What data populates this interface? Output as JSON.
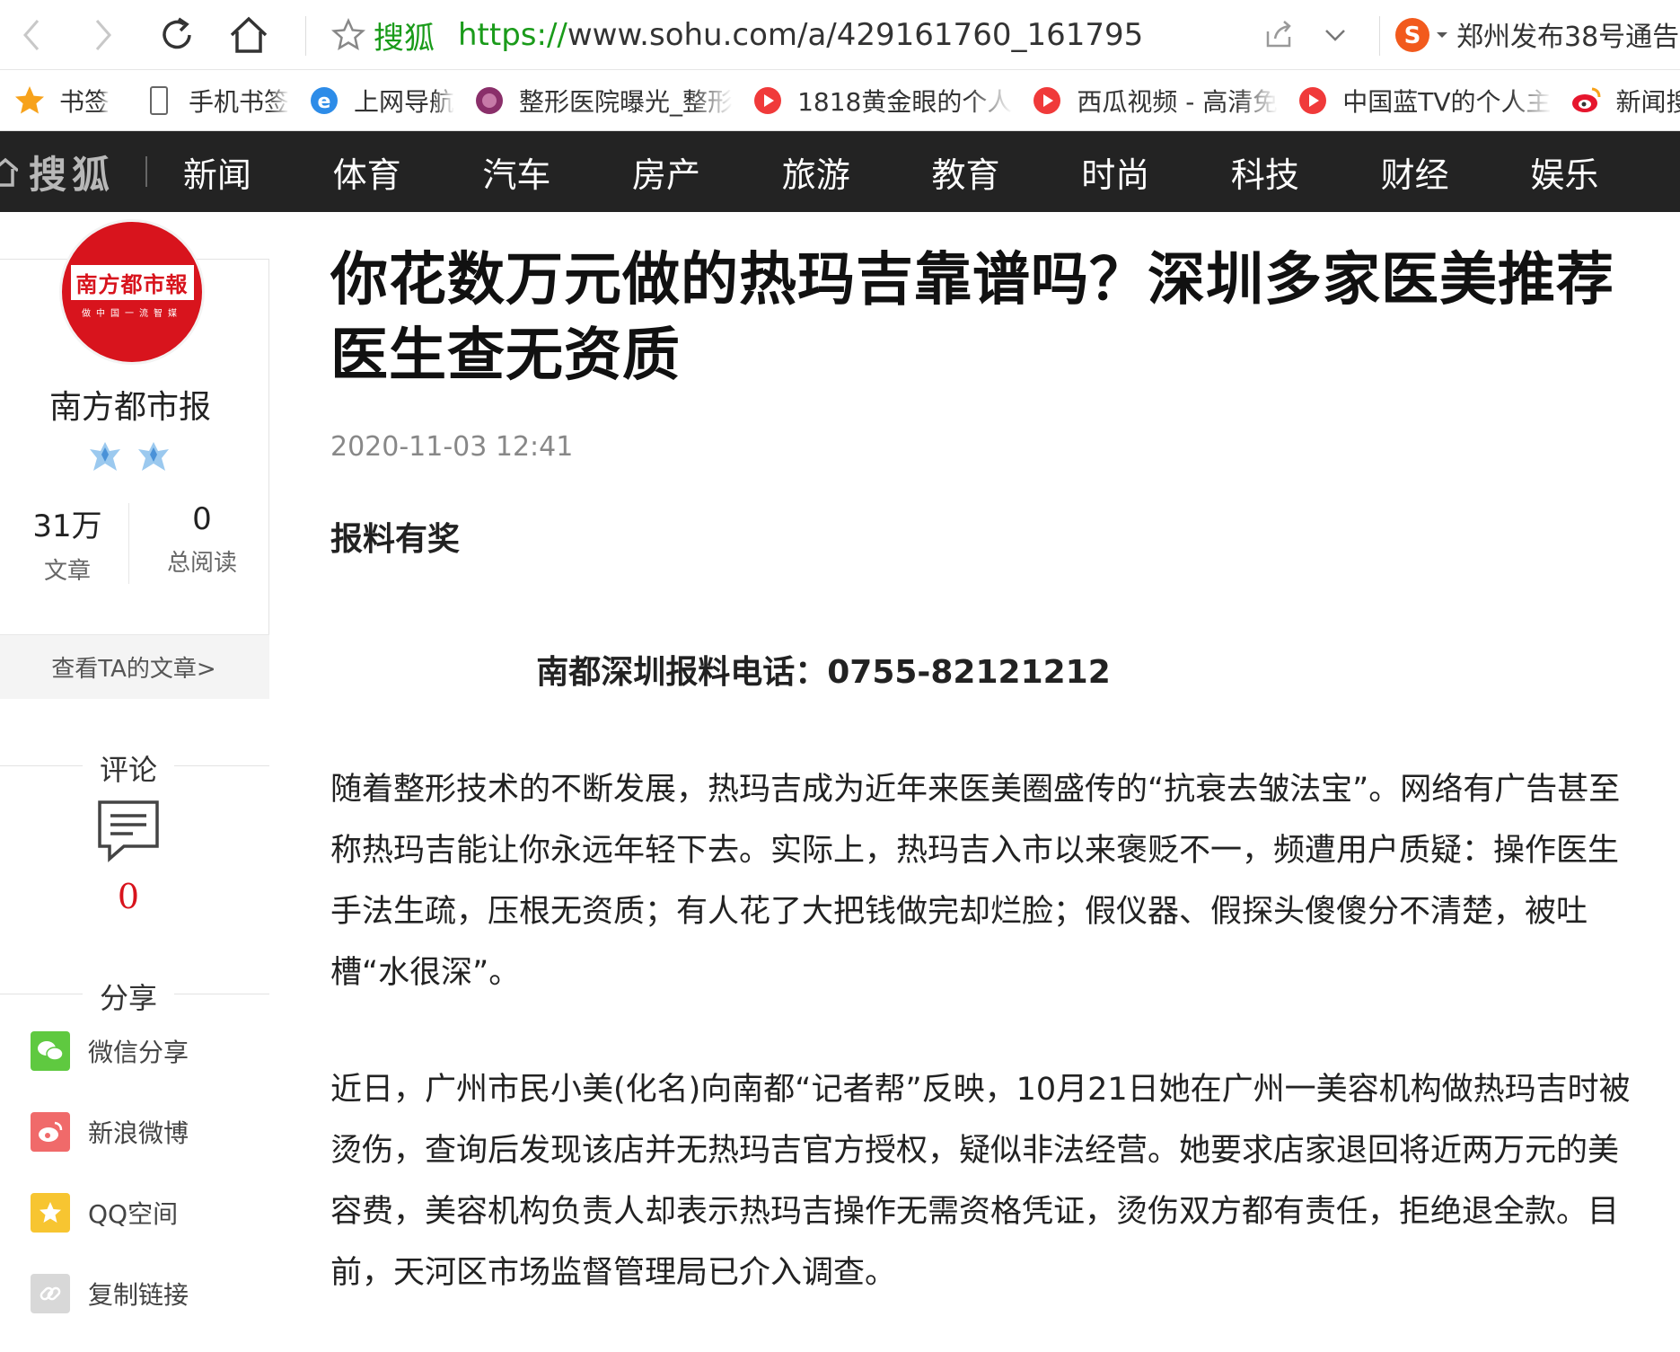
{
  "browser": {
    "site_name": "搜狐",
    "url_scheme": "https://",
    "url_rest": "www.sohu.com/a/429161760_161795",
    "news_ticker": "郑州发布38号通告"
  },
  "bookmarks": [
    {
      "label": "书签",
      "icon": "star-icon"
    },
    {
      "label": "手机书签",
      "icon": "phone-icon"
    },
    {
      "label": "上网导航",
      "icon": "ie-icon"
    },
    {
      "label": "整形医院曝光_整形",
      "icon": "hospital-icon"
    },
    {
      "label": "1818黄金眼的个人",
      "icon": "play-icon"
    },
    {
      "label": "西瓜视频 - 高清免",
      "icon": "play-icon"
    },
    {
      "label": "中国蓝TV的个人主",
      "icon": "play-icon"
    },
    {
      "label": "新闻搜索",
      "icon": "weibo-icon"
    }
  ],
  "site_nav": {
    "logo": "搜狐",
    "items": [
      "新闻",
      "体育",
      "汽车",
      "房产",
      "旅游",
      "教育",
      "时尚",
      "科技",
      "财经",
      "娱乐"
    ]
  },
  "author": {
    "logo_text": "南方都市報",
    "logo_sub": "做中国一流智媒",
    "name": "南方都市报",
    "articles_value": "31万",
    "articles_label": "文章",
    "reads_value": "0",
    "reads_label": "总阅读",
    "link": "查看TA的文章>"
  },
  "comments": {
    "title": "评论",
    "count": "0"
  },
  "share": {
    "title": "分享",
    "items": [
      {
        "label": "微信分享",
        "color": "#5fc940"
      },
      {
        "label": "新浪微博",
        "color": "#f06a6a"
      },
      {
        "label": "QQ空间",
        "color": "#f7c531"
      },
      {
        "label": "复制链接",
        "color": "#d8d8d8"
      }
    ]
  },
  "article": {
    "title": "你花数万元做的热玛吉靠谱吗？深圳多家医美推荐医生查无资质",
    "date": "2020-11-03 12:41",
    "lead": "报料有奖",
    "hotline": "南都深圳报料电话：0755-82121212",
    "para1": "随着整形技术的不断发展，热玛吉成为近年来医美圈盛传的“抗衰去皱法宝”。网络有广告甚至称热玛吉能让你永远年轻下去。实际上，热玛吉入市以来褒贬不一，频遭用户质疑：操作医生手法生疏，压根无资质；有人花了大把钱做完却烂脸；假仪器、假探头傻傻分不清楚，被吐槽“水很深”。",
    "para2": "近日，广州市民小美(化名)向南都“记者帮”反映，10月21日她在广州一美容机构做热玛吉时被烫伤，查询后发现该店并无热玛吉官方授权，疑似非法经营。她要求店家退回将近两万元的美容费，美容机构负责人却表示热玛吉操作无需资格凭证，烫伤双方都有责任，拒绝退全款。目前，天河区市场监督管理局已介入调查。"
  },
  "colors": {
    "accent_red": "#d8141d",
    "nav_bg": "#232323",
    "url_green": "#1a9b1a"
  }
}
